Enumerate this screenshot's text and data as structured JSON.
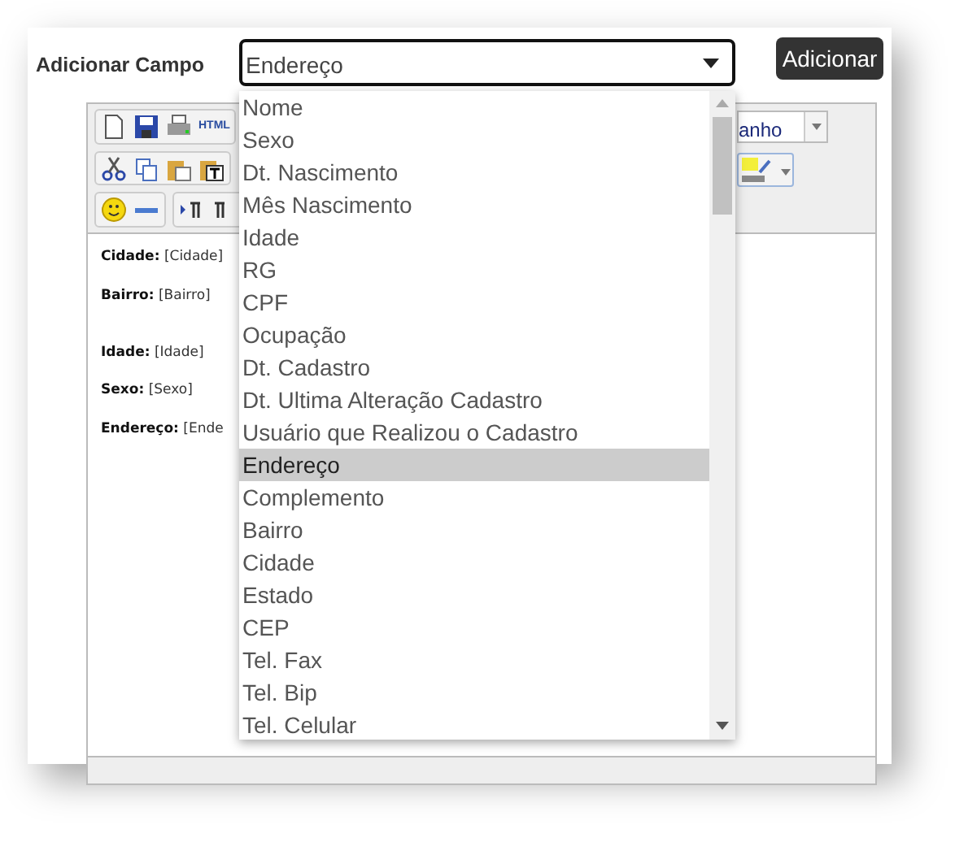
{
  "label": "Adicionar Campo",
  "select": {
    "value": "Endereço"
  },
  "button": "Adicionar",
  "toolbar": {
    "html_icon": "HTML",
    "font_size_value": "anho"
  },
  "editor_lines": [
    {
      "label": "Cidade:",
      "value": "[Cidade]"
    },
    {
      "label": "Bairro:",
      "value": "[Bairro]"
    },
    {
      "label": "Idade:",
      "value": "[Idade]"
    },
    {
      "label": "Sexo:",
      "value": "[Sexo]"
    },
    {
      "label": "Endereço:",
      "value": "[Ende"
    }
  ],
  "options": [
    {
      "label": "Nome",
      "selected": false
    },
    {
      "label": "Sexo",
      "selected": false
    },
    {
      "label": "Dt. Nascimento",
      "selected": false
    },
    {
      "label": "Mês Nascimento",
      "selected": false
    },
    {
      "label": "Idade",
      "selected": false
    },
    {
      "label": "RG",
      "selected": false
    },
    {
      "label": "CPF",
      "selected": false
    },
    {
      "label": "Ocupação",
      "selected": false
    },
    {
      "label": "Dt. Cadastro",
      "selected": false
    },
    {
      "label": "Dt. Ultima Alteração Cadastro",
      "selected": false
    },
    {
      "label": "Usuário que Realizou o Cadastro",
      "selected": false
    },
    {
      "label": "Endereço",
      "selected": true
    },
    {
      "label": "Complemento",
      "selected": false
    },
    {
      "label": "Bairro",
      "selected": false
    },
    {
      "label": "Cidade",
      "selected": false
    },
    {
      "label": "Estado",
      "selected": false
    },
    {
      "label": "CEP",
      "selected": false
    },
    {
      "label": "Tel. Fax",
      "selected": false
    },
    {
      "label": "Tel. Bip",
      "selected": false
    },
    {
      "label": "Tel. Celular",
      "selected": false
    }
  ]
}
